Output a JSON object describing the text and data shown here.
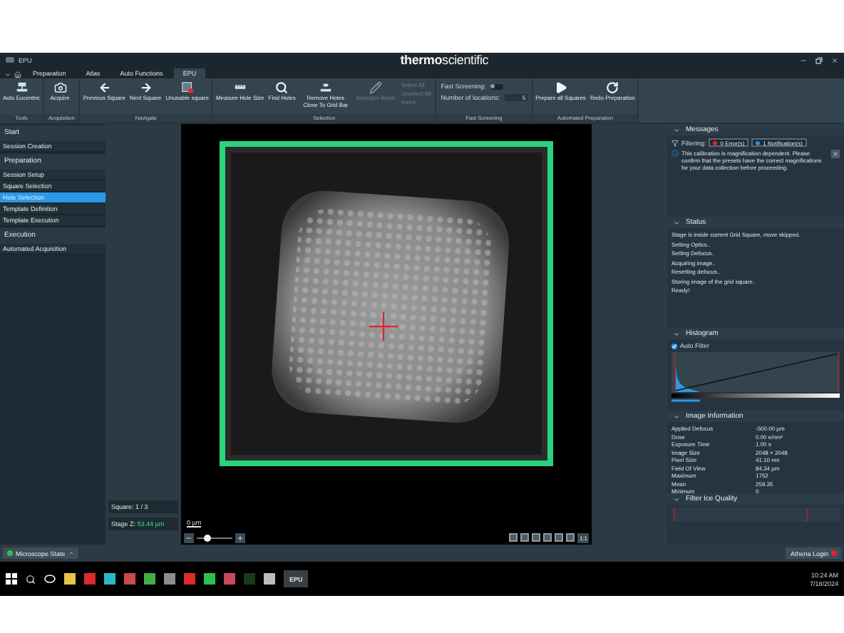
{
  "window": {
    "title": "EPU",
    "logo": "**thermo**scientific"
  },
  "tabs": [
    {
      "label": "Preparation",
      "selected": false
    },
    {
      "label": "Atlas",
      "selected": false
    },
    {
      "label": "Auto Functions",
      "selected": false
    },
    {
      "label": "EPU",
      "selected": true
    }
  ],
  "ribbon": [
    {
      "label": "Tools",
      "buttons": [
        {
          "label": "Auto Eucentric",
          "kind": "stage",
          "disabled": false
        }
      ]
    },
    {
      "label": "Acquisition",
      "buttons": [
        {
          "label": "Acquire",
          "kind": "camera",
          "disabled": false
        }
      ]
    },
    {
      "label": "Navigate",
      "buttons": [
        {
          "label": "Previous Square",
          "kind": "left",
          "disabled": false
        },
        {
          "label": "Next Square",
          "kind": "right",
          "disabled": false
        },
        {
          "label": "Unusable square",
          "kind": "unusable",
          "disabled": false
        }
      ]
    },
    {
      "label": "Selection",
      "buttons": [
        {
          "label": "Measure Hole Size",
          "kind": "measure",
          "disabled": false
        },
        {
          "label": "Find Holes",
          "kind": "search",
          "disabled": false
        },
        {
          "label": "Remove Holes Close To Grid Bar",
          "kind": "remove",
          "disabled": false
        },
        {
          "label": "Selection Brush",
          "kind": "brush",
          "disabled": true
        }
      ],
      "small_buttons": [
        {
          "label": "Select All",
          "disabled": true
        },
        {
          "label": "Unselect All",
          "disabled": true
        },
        {
          "label": "Invert",
          "disabled": true
        }
      ]
    },
    {
      "label": "Fast Screening",
      "toggle": {
        "label": "Fast Screening:",
        "on": false
      },
      "field": {
        "label": "Number of locations:",
        "value": "5"
      }
    },
    {
      "label": "Automated Preparation",
      "buttons": [
        {
          "label": "Prepare all Squares",
          "kind": "play",
          "disabled": false
        },
        {
          "label": "Redo Preparation",
          "kind": "redo",
          "disabled": false
        }
      ]
    }
  ],
  "sidebar": [
    {
      "title": "Start",
      "items": [
        {
          "label": "Session Creation",
          "selected": false
        }
      ]
    },
    {
      "title": "Preparation",
      "items": [
        {
          "label": "Session Setup",
          "selected": false
        },
        {
          "label": "Square Selection",
          "selected": false
        },
        {
          "label": "Hole Selection",
          "selected": true
        },
        {
          "label": "Template Definition",
          "selected": false
        },
        {
          "label": "Template Execution",
          "selected": false
        }
      ]
    },
    {
      "title": "Execution",
      "items": [
        {
          "label": "Automated Acquisition",
          "selected": false
        }
      ]
    }
  ],
  "stage_info": {
    "square": "Square: 1 / 3",
    "stage_z_label": "Stage Z:",
    "stage_z_value": "53.44 µm"
  },
  "viewer": {
    "scale_label": "0 µm",
    "zoom": {
      "level": 0.3
    },
    "one_to_one": "1:1"
  },
  "messages": {
    "title": "Messages",
    "filter_label": "Filtering:",
    "filters": [
      {
        "label": "0 Error(s)",
        "color": "#e0262f"
      },
      {
        "label": "1 Notification(s)",
        "color": "#2a8ee0"
      }
    ],
    "items": [
      "This calibration is magnification dependent. Please confirm that the presets have the correct magnifications for your data collection before proceeding."
    ]
  },
  "status": {
    "title": "Status",
    "lines": [
      "Stage is inside current Grid Square, move skipped.",
      "Setting Optics..",
      "Setting Defocus..",
      "Acquiring image..",
      "Resetting defocus..",
      "Storing image of the grid square..",
      "Ready!"
    ]
  },
  "histogram": {
    "title": "Histogram",
    "auto_filter": {
      "label": "Auto Filter",
      "checked": true
    }
  },
  "image_information": {
    "title": "Image Information",
    "rows": [
      {
        "label": "Applied Defocus",
        "value": "-500.00 µm"
      },
      {
        "label": "Dose",
        "value": "0.00 e/nm²"
      },
      {
        "label": "Exposure Time",
        "value": "1.00 s"
      },
      {
        "label": "Image Size",
        "value": "2048 × 2048"
      },
      {
        "label": "Pixel Size",
        "value": "41.10 nm"
      },
      {
        "label": "Field Of View",
        "value": "84.34 µm"
      },
      {
        "label": "Maximum",
        "value": "1752"
      },
      {
        "label": "Mean",
        "value": "259.35"
      },
      {
        "label": "Minimum",
        "value": "0"
      }
    ]
  },
  "filter_ice_quality": {
    "title": "Filter Ice Quality"
  },
  "status_bar": {
    "microscope_state": "Microscope State",
    "athena_login": "Athena Login"
  },
  "taskbar": {
    "active_app": "EPU",
    "time": "10:24 AM",
    "date": "7/18/2024"
  }
}
